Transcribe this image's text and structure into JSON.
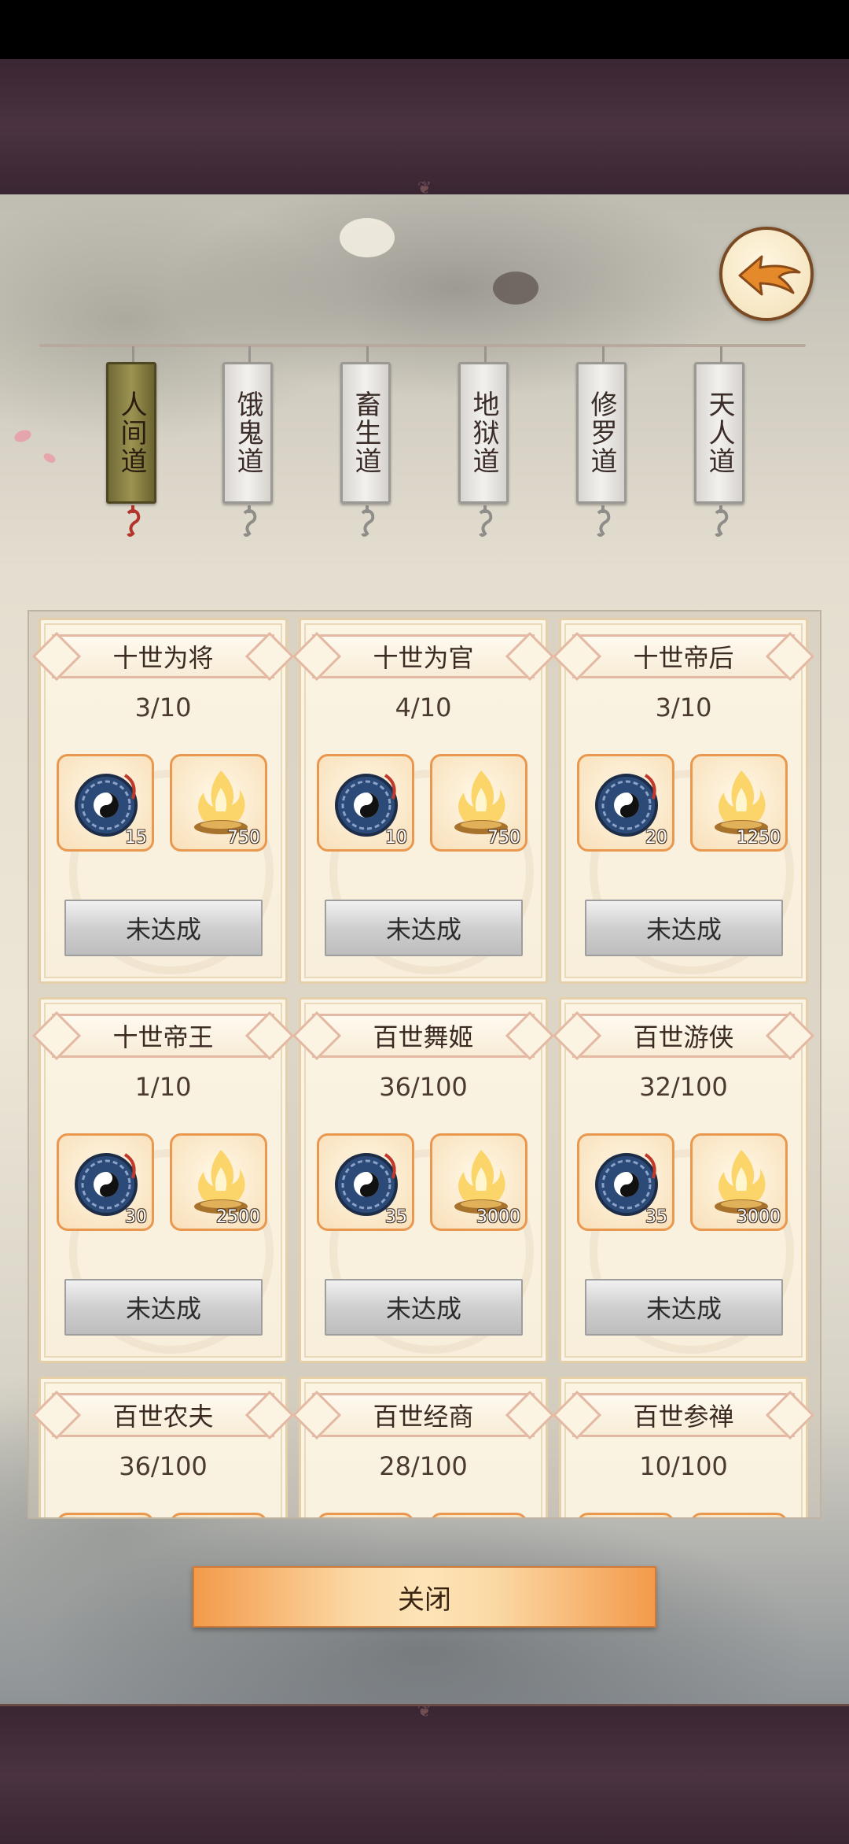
{
  "tabs": [
    {
      "label": "人间道",
      "active": true
    },
    {
      "label": "饿鬼道",
      "active": false
    },
    {
      "label": "畜生道",
      "active": false
    },
    {
      "label": "地狱道",
      "active": false
    },
    {
      "label": "修罗道",
      "active": false
    },
    {
      "label": "天人道",
      "active": false
    }
  ],
  "cards": [
    {
      "title": "十世为将",
      "progress": "3/10",
      "reward1_count": "15",
      "reward2_count": "750",
      "status": "未达成"
    },
    {
      "title": "十世为官",
      "progress": "4/10",
      "reward1_count": "10",
      "reward2_count": "750",
      "status": "未达成"
    },
    {
      "title": "十世帝后",
      "progress": "3/10",
      "reward1_count": "20",
      "reward2_count": "1250",
      "status": "未达成"
    },
    {
      "title": "十世帝王",
      "progress": "1/10",
      "reward1_count": "30",
      "reward2_count": "2500",
      "status": "未达成"
    },
    {
      "title": "百世舞姬",
      "progress": "36/100",
      "reward1_count": "35",
      "reward2_count": "3000",
      "status": "未达成"
    },
    {
      "title": "百世游侠",
      "progress": "32/100",
      "reward1_count": "35",
      "reward2_count": "3000",
      "status": "未达成"
    },
    {
      "title": "百世农夫",
      "progress": "36/100"
    },
    {
      "title": "百世经商",
      "progress": "28/100"
    },
    {
      "title": "百世参禅",
      "progress": "10/100"
    }
  ],
  "close_label": "关闭",
  "icons": {
    "back": "back-arrow-icon",
    "reward1": "bagua-compass-icon",
    "reward2": "spirit-flame-icon"
  },
  "colors": {
    "accent": "#f39a4a",
    "active_tab": "#8c8545",
    "reward_border": "#e9984f"
  }
}
